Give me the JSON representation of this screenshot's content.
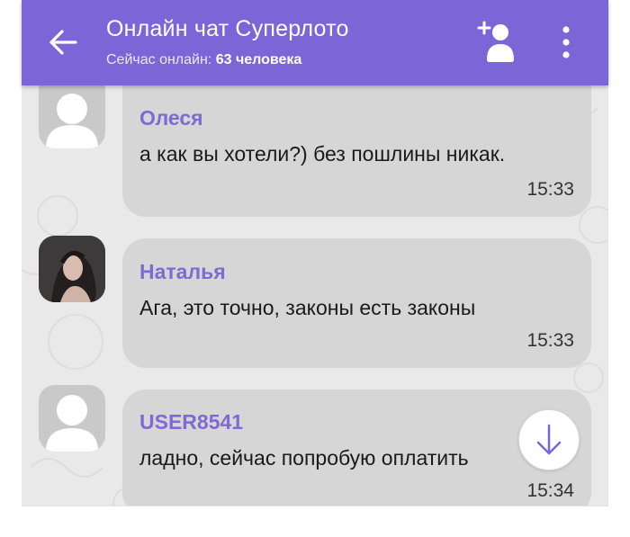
{
  "header": {
    "title": "Онлайн чат Суперлото",
    "online_prefix": "Сейчас онлайн:",
    "online_count": "63 человека",
    "back_icon": "arrow-left-icon",
    "add_user_icon": "add-user-icon",
    "menu_icon": "more-vertical-icon"
  },
  "messages": [
    {
      "author": "Олеся",
      "text": "а как вы хотели?) без пошлины никак.",
      "time": "15:33",
      "avatar": "default-avatar"
    },
    {
      "author": "Наталья",
      "text": "Ага, это точно, законы есть законы",
      "time": "15:33",
      "avatar": "photo-avatar"
    },
    {
      "author": "USER8541",
      "text": "ладно, сейчас попробую оплатить",
      "time": "15:34",
      "avatar": "default-avatar"
    }
  ],
  "scroll_button_icon": "arrow-down-icon",
  "colors": {
    "accent": "#7a66d6",
    "author": "#7d6ad2",
    "bubble": "#d6d6d6",
    "background": "#e9e9e9"
  }
}
